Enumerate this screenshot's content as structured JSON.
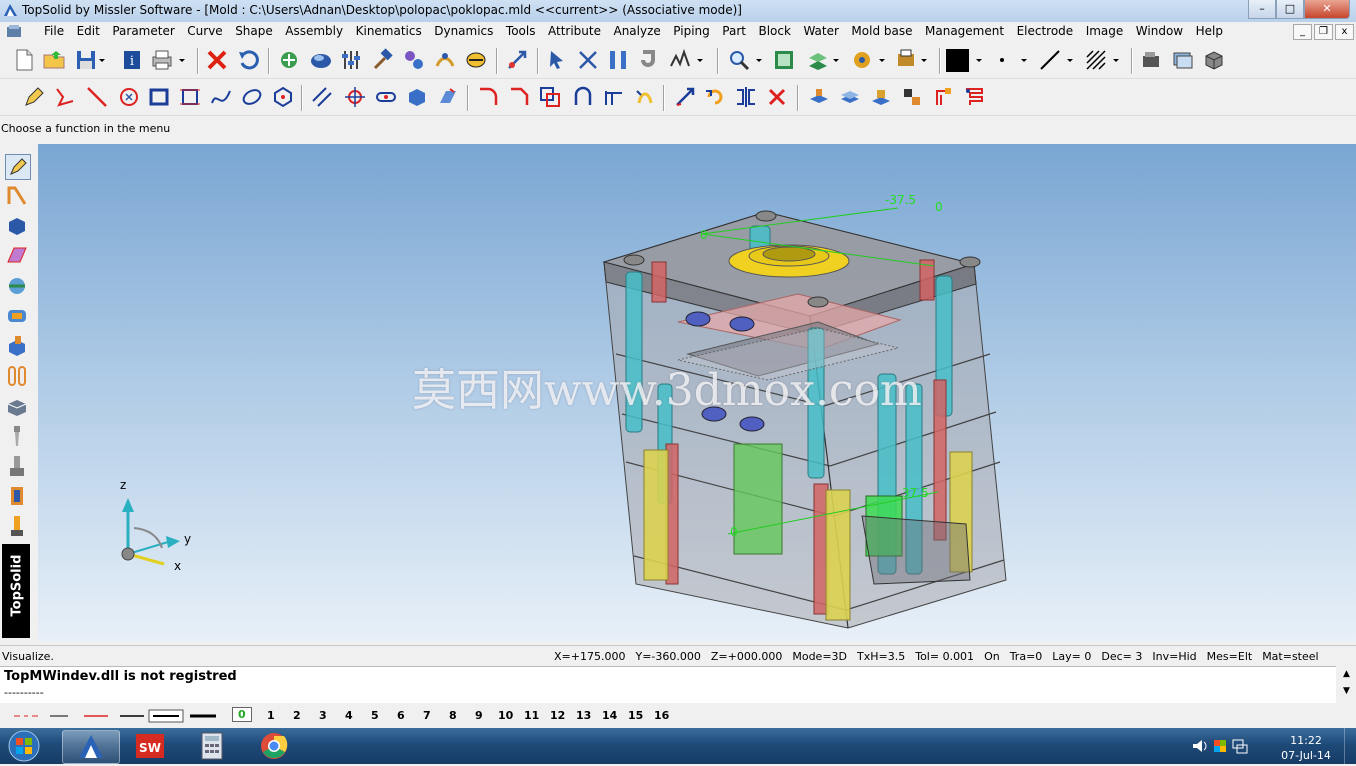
{
  "window": {
    "title": "TopSolid by Missler Software - [Mold : C:\\Users\\Adnan\\Desktop\\polopac\\poklopac.mld  <<current>> (Associative mode)]",
    "minimize": "–",
    "maximize": "□",
    "close": "✕"
  },
  "menu": {
    "items": [
      "File",
      "Edit",
      "Parameter",
      "Curve",
      "Shape",
      "Assembly",
      "Kinematics",
      "Dynamics",
      "Tools",
      "Attribute",
      "Analyze",
      "Piping",
      "Part",
      "Block",
      "Water",
      "Mold base",
      "Management",
      "Electrode",
      "Image",
      "Window",
      "Help"
    ],
    "mdi_minimize": "_",
    "mdi_restore": "❐",
    "mdi_close": "x"
  },
  "hint": "Choose a function in the menu",
  "sidebar": {
    "brand": "TopSolid"
  },
  "viewport": {
    "watermark": "莫西网www.3dmox.com",
    "dim_label_top": "-37.5",
    "dim_label_zero_a": "0",
    "dim_label_zero_b": "0",
    "dim_label_zero_c": "0",
    "dim_label_mid": "37.5",
    "axis_z": "z",
    "axis_y": "y",
    "axis_x": "x",
    "colors": {
      "bg_top": "#7aa6d3",
      "bg_bottom": "#e8f0f8",
      "dim": "#22dd22"
    }
  },
  "status": {
    "mode_label": "Visualize.",
    "fields": [
      "X=+175.000",
      "Y=-360.000",
      "Z=+000.000",
      "Mode=3D",
      "TxH=3.5",
      "Tol= 0.001",
      "On",
      "Tra=0",
      "Lay= 0",
      "Dec= 3",
      "Inv=Hid",
      "Mes=Elt",
      "Mat=steel"
    ]
  },
  "messages": {
    "line1": "TopMWindev.dll is not registred",
    "line2": "----------"
  },
  "layers": {
    "items": [
      "0",
      "1",
      "2",
      "3",
      "4",
      "5",
      "6",
      "7",
      "8",
      "9",
      "10",
      "11",
      "12",
      "13",
      "14",
      "15",
      "16"
    ],
    "active": "0"
  },
  "taskbar": {
    "clock_time": "11:22",
    "clock_date": "07-Jul-14"
  }
}
